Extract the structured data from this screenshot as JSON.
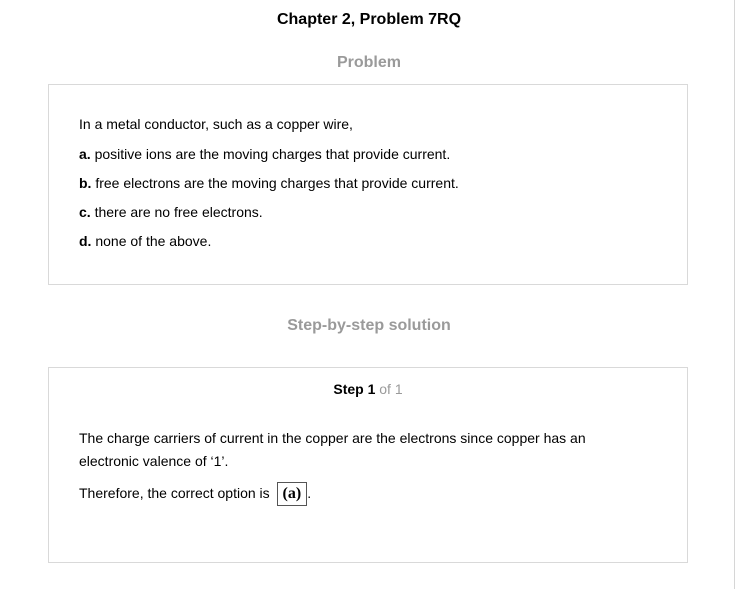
{
  "header": {
    "title": "Chapter 2, Problem 7RQ"
  },
  "problem": {
    "heading": "Problem",
    "intro": "In a metal conductor, such as a copper wire,",
    "options": [
      {
        "letter": "a.",
        "text": "positive ions are the moving charges that provide current."
      },
      {
        "letter": "b.",
        "text": "free electrons are the moving charges that provide current."
      },
      {
        "letter": "c.",
        "text": "there are no free electrons."
      },
      {
        "letter": "d.",
        "text": "none of the above."
      }
    ]
  },
  "solution": {
    "heading": "Step-by-step solution",
    "step_label": "Step 1",
    "step_of": "of 1",
    "explanation": "The charge carriers of current in the copper are the electrons since copper has an electronic valence of ‘1’.",
    "conclusion_prefix": "Therefore, the correct option is",
    "answer": "(a)",
    "conclusion_suffix": "."
  }
}
